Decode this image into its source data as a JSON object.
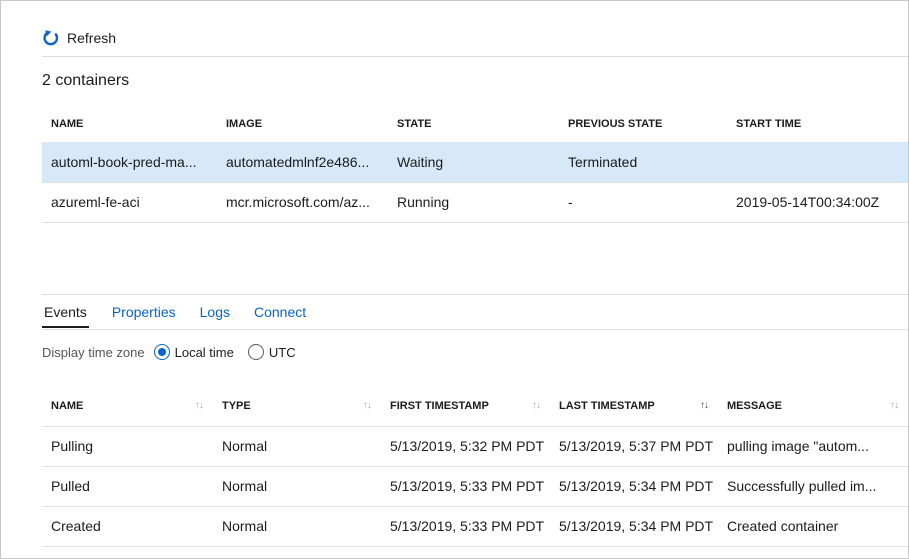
{
  "toolbar": {
    "refresh_label": "Refresh"
  },
  "containers": {
    "count_label": "2 containers",
    "columns": [
      "NAME",
      "IMAGE",
      "STATE",
      "PREVIOUS STATE",
      "START TIME"
    ],
    "rows": [
      [
        "automl-book-pred-ma...",
        "automatedmlnf2e486...",
        "Waiting",
        "Terminated",
        ""
      ],
      [
        "azureml-fe-aci",
        "mcr.microsoft.com/az...",
        "Running",
        "-",
        "2019-05-14T00:34:00Z"
      ]
    ],
    "selected_row": 0
  },
  "tabs": [
    "Events",
    "Properties",
    "Logs",
    "Connect"
  ],
  "active_tab": "Events",
  "timezone": {
    "label": "Display time zone",
    "options": [
      "Local time",
      "UTC"
    ],
    "selected": "Local time"
  },
  "events": {
    "columns": [
      "NAME",
      "TYPE",
      "FIRST TIMESTAMP",
      "LAST TIMESTAMP",
      "MESSAGE"
    ],
    "rows": [
      [
        "Pulling",
        "Normal",
        "5/13/2019, 5:32 PM PDT",
        "5/13/2019, 5:37 PM PDT",
        "pulling image \"autom..."
      ],
      [
        "Pulled",
        "Normal",
        "5/13/2019, 5:33 PM PDT",
        "5/13/2019, 5:34 PM PDT",
        "Successfully pulled im..."
      ],
      [
        "Created",
        "Normal",
        "5/13/2019, 5:33 PM PDT",
        "5/13/2019, 5:34 PM PDT",
        "Created container"
      ]
    ]
  },
  "colors": {
    "accent": "#0b63c4",
    "selected_row": "#d7e9f8"
  }
}
